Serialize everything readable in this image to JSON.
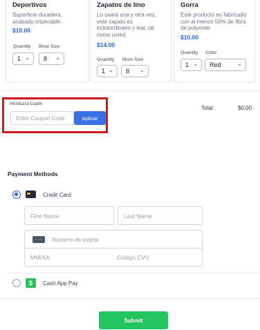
{
  "products": [
    {
      "title": "Deportivos",
      "description": "Superficie duradera, acabado impecable.",
      "price": "$10.00",
      "options": [
        {
          "label": "Quantity",
          "value": "1"
        },
        {
          "label": "Shoe Size",
          "value": "8"
        }
      ]
    },
    {
      "title": "Zapatos de lino",
      "description": "Lo usará una y otra vez, este zapato es extraordinario y leal, tal como usted.",
      "price": "$14.00",
      "options": [
        {
          "label": "Quantity",
          "value": "1"
        },
        {
          "label": "Shoe Size",
          "value": "8"
        }
      ]
    },
    {
      "title": "Gorra",
      "description": "Este producto es fabricado con al menos 50% de fibra de polyester.",
      "price": "$10.00",
      "options": [
        {
          "label": "Quantity",
          "value": "1"
        },
        {
          "label": "Color",
          "value": "Red"
        }
      ]
    }
  ],
  "coupon": {
    "label": "Introduzca Cupón",
    "placeholder": "Enter Coupon Code",
    "apply_label": "Aplicar"
  },
  "summary": {
    "total_label": "Total",
    "total_value": "$0.00"
  },
  "payment": {
    "title": "Payment Methods",
    "credit_card": {
      "label": "Credit Card",
      "selected": true,
      "first_name_placeholder": "First Name",
      "last_name_placeholder": "Last Name",
      "card_number_placeholder": "Número de tarjeta",
      "expiry_placeholder": "MM/AA",
      "cvv_placeholder": "Código CVV"
    },
    "cash_app": {
      "label": "Cash App Pay",
      "selected": false,
      "icon_glyph": "$"
    }
  },
  "submit_label": "Submit",
  "colors": {
    "accent_blue": "#3a6fe8",
    "price_blue": "#2563eb",
    "highlight_red": "#d0161c",
    "submit_green": "#22c55e"
  }
}
